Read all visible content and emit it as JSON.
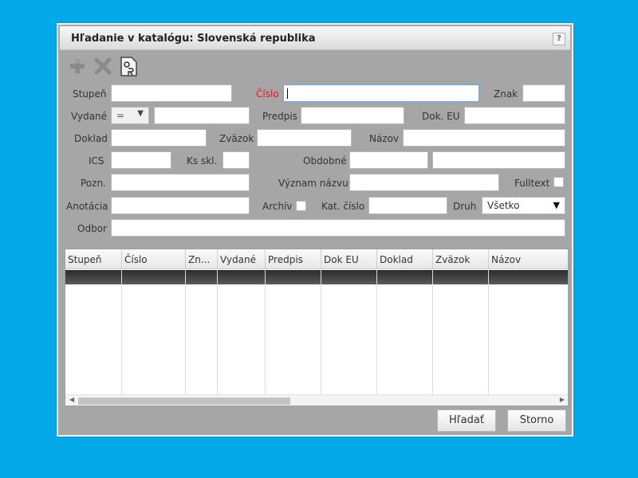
{
  "dialog": {
    "title": "Hľadanie v katalógu: Slovenská republika",
    "help_label": "?"
  },
  "toolbar": {
    "icons": [
      "add-icon",
      "delete-icon",
      "or-document-icon"
    ]
  },
  "form": {
    "stupen_label": "Stupeň",
    "cislo_label": "Číslo",
    "znak_label": "Znak",
    "vydane_label": "Vydané",
    "vydane_operator": "=",
    "predpis_label": "Predpis",
    "dok_eu_label": "Dok. EU",
    "doklad_label": "Doklad",
    "zvazok_label": "Zväzok",
    "nazov_label": "Názov",
    "ics_label": "ICS",
    "ks_skl_label": "Ks skl.",
    "obdobne_label": "Obdobné",
    "pozn_label": "Pozn.",
    "vyznam_nazvu_label": "Význam názvu",
    "fulltext_label": "Fulltext",
    "anotacia_label": "Anotácia",
    "archiv_label": "Archív",
    "kat_cislo_label": "Kat. číslo",
    "druh_label": "Druh",
    "druh_value": "Všetko",
    "odbor_label": "Odbor"
  },
  "grid": {
    "columns": [
      "Stupeň",
      "Číslo",
      "Zn...",
      "Vydané",
      "Predpis",
      "Dok EU",
      "Doklad",
      "Zväzok",
      "Názov"
    ]
  },
  "buttons": {
    "search_label": "Hľadať",
    "cancel_label": "Storno"
  },
  "colors": {
    "background": "#03a9e8",
    "dialog_body": "#a6a6a6",
    "required_label": "#e8141b",
    "selected_row": "#2b2b2b"
  }
}
